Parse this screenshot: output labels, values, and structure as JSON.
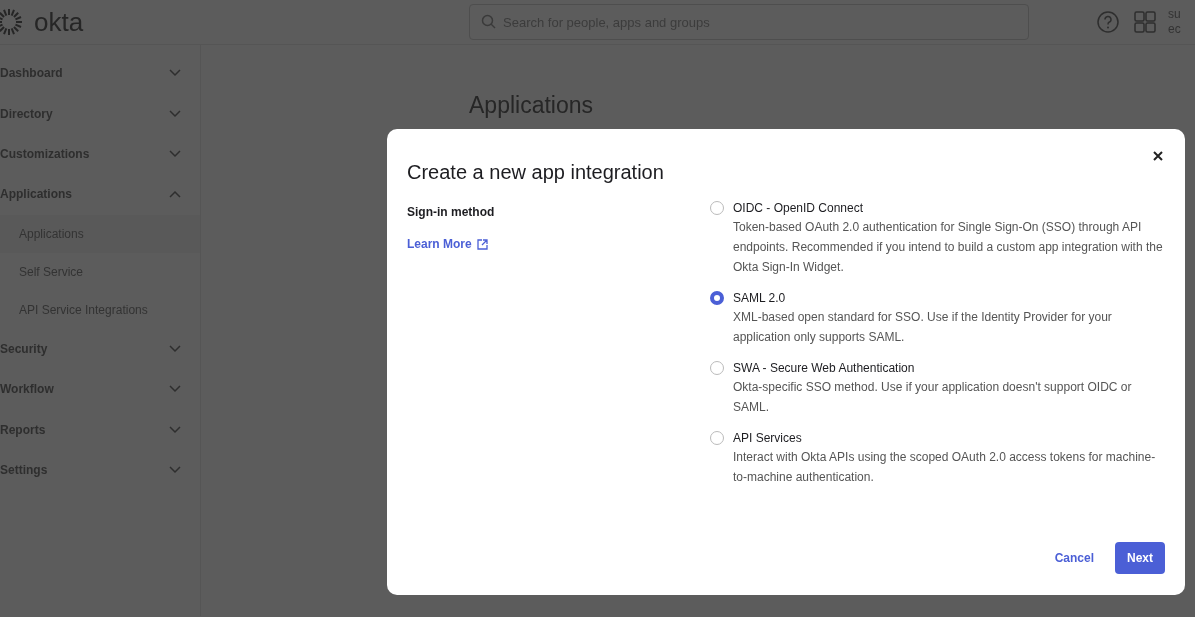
{
  "header": {
    "logo": "okta",
    "search": {
      "placeholder": "Search for people, apps and groups"
    },
    "user_lines": [
      "su",
      "ec"
    ]
  },
  "sidebar": {
    "items": [
      {
        "label": "Dashboard",
        "expanded": false
      },
      {
        "label": "Directory",
        "expanded": false
      },
      {
        "label": "Customizations",
        "expanded": false
      },
      {
        "label": "Applications",
        "expanded": true,
        "children": [
          {
            "label": "Applications",
            "selected": true
          },
          {
            "label": "Self Service",
            "selected": false
          },
          {
            "label": "API Service Integrations",
            "selected": false
          }
        ]
      },
      {
        "label": "Security",
        "expanded": false
      },
      {
        "label": "Workflow",
        "expanded": false
      },
      {
        "label": "Reports",
        "expanded": false
      },
      {
        "label": "Settings",
        "expanded": false
      }
    ]
  },
  "page_title": "Applications",
  "dialog": {
    "title": "Create a new app integration",
    "field_label": "Sign-in method",
    "learn_more": "Learn More",
    "options": [
      {
        "label": "OIDC - OpenID Connect",
        "description": "Token-based OAuth 2.0 authentication for Single Sign-On (SSO) through API endpoints. Recommended if you intend to build a custom app integration with the Okta Sign-In Widget.",
        "selected": false
      },
      {
        "label": "SAML 2.0",
        "description": "XML-based open standard for SSO. Use if the Identity Provider for your application only supports SAML.",
        "selected": true
      },
      {
        "label": "SWA - Secure Web Authentication",
        "description": "Okta-specific SSO method. Use if your application doesn't support OIDC or SAML.",
        "selected": false
      },
      {
        "label": "API Services",
        "description": "Interact with Okta APIs using the scoped OAuth 2.0 access tokens for machine-to-machine authentication.",
        "selected": false
      }
    ],
    "buttons": {
      "cancel": "Cancel",
      "next": "Next"
    }
  }
}
